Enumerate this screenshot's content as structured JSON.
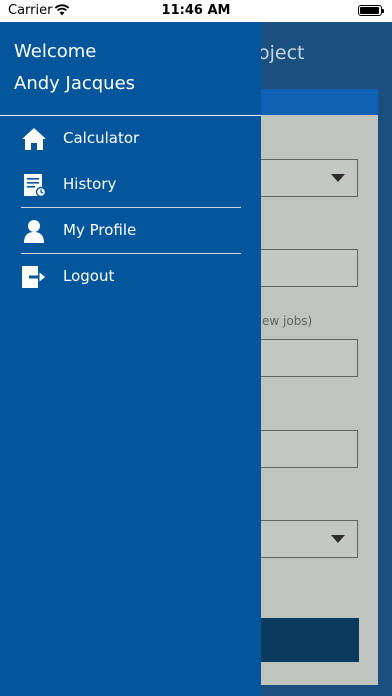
{
  "status_bar": {
    "carrier": "Carrier",
    "time": "11:46 AM",
    "wifi_icon": "wifi-icon",
    "battery_icon": "battery-icon"
  },
  "background_app": {
    "title_fragment": "oject",
    "hint_fragment": "ew jobs)"
  },
  "drawer": {
    "welcome": "Welcome",
    "user_name": "Andy Jacques",
    "items": [
      {
        "label": "Calculator",
        "icon": "home-icon"
      },
      {
        "label": "History",
        "icon": "history-list-icon"
      },
      {
        "label": "My Profile",
        "icon": "person-icon"
      },
      {
        "label": "Logout",
        "icon": "logout-icon"
      }
    ]
  },
  "colors": {
    "drawer": "#03569c",
    "app_background": "#1a4f7e",
    "panel": "#bfc4bd"
  }
}
